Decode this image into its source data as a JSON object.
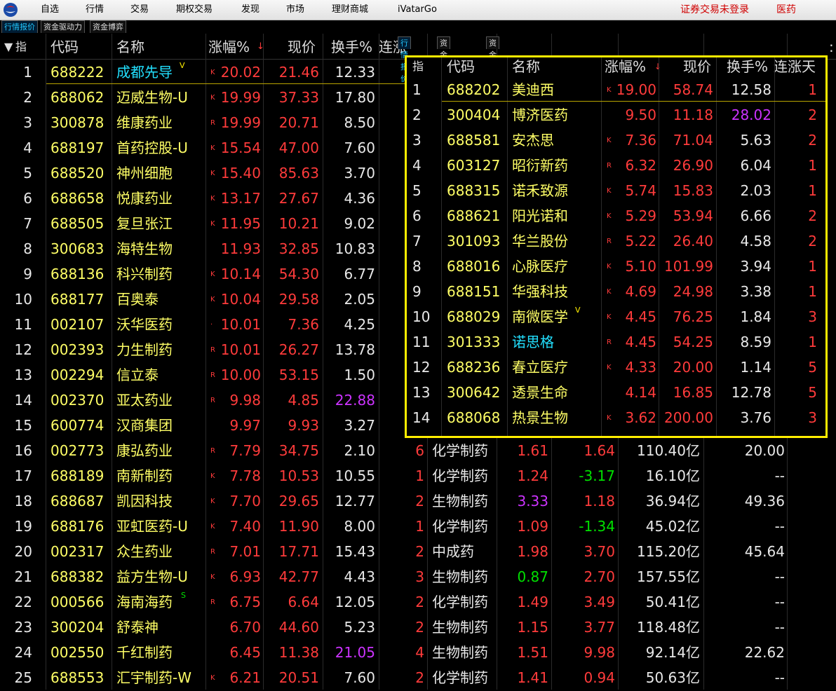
{
  "menu": {
    "items": [
      "自选",
      "行情",
      "交易",
      "期权交易",
      "发现",
      "市场",
      "理财商城",
      "iVatarGo"
    ],
    "login_status": "证券交易未登录",
    "sector": "医药"
  },
  "tabs": [
    "行情报价",
    "资金驱动力",
    "资金博弈"
  ],
  "table": {
    "headers": [
      "指",
      "代码",
      "名称",
      "涨幅%",
      "现价",
      "换手%",
      "连涨"
    ],
    "rows": [
      {
        "idx": "1",
        "code": "688222",
        "name": "成都先导",
        "name_color": "cyan",
        "sup": "V",
        "flag": "K",
        "chg": "20.02",
        "price": "21.46",
        "turn": "12.33"
      },
      {
        "idx": "2",
        "code": "688062",
        "name": "迈威生物-U",
        "flag": "K",
        "chg": "19.99",
        "price": "37.33",
        "turn": "17.80"
      },
      {
        "idx": "3",
        "code": "300878",
        "name": "维康药业",
        "flag": "R",
        "chg": "19.99",
        "price": "20.71",
        "turn": "8.50"
      },
      {
        "idx": "4",
        "code": "688197",
        "name": "首药控股-U",
        "flag": "K",
        "chg": "15.54",
        "price": "47.00",
        "turn": "7.60"
      },
      {
        "idx": "5",
        "code": "688520",
        "name": "神州细胞",
        "flag": "K",
        "chg": "15.40",
        "price": "85.63",
        "turn": "3.70"
      },
      {
        "idx": "6",
        "code": "688658",
        "name": "悦康药业",
        "flag": "K",
        "chg": "13.17",
        "price": "27.67",
        "turn": "4.36"
      },
      {
        "idx": "7",
        "code": "688505",
        "name": "复旦张江",
        "flag": "K",
        "chg": "11.95",
        "price": "10.21",
        "turn": "9.02"
      },
      {
        "idx": "8",
        "code": "300683",
        "name": "海特生物",
        "flag": "",
        "chg": "11.93",
        "price": "32.85",
        "turn": "10.83"
      },
      {
        "idx": "9",
        "code": "688136",
        "name": "科兴制药",
        "flag": "K",
        "chg": "10.14",
        "price": "54.30",
        "turn": "6.77"
      },
      {
        "idx": "10",
        "code": "688177",
        "name": "百奥泰",
        "flag": "K",
        "chg": "10.04",
        "price": "29.58",
        "turn": "2.05"
      },
      {
        "idx": "11",
        "code": "002107",
        "name": "沃华医药",
        "flag": "·",
        "chg": "10.01",
        "price": "7.36",
        "turn": "4.25"
      },
      {
        "idx": "12",
        "code": "002393",
        "name": "力生制药",
        "flag": "R",
        "chg": "10.01",
        "price": "26.27",
        "turn": "13.78"
      },
      {
        "idx": "13",
        "code": "002294",
        "name": "信立泰",
        "flag": "R",
        "chg": "10.00",
        "price": "53.15",
        "turn": "1.50"
      },
      {
        "idx": "14",
        "code": "002370",
        "name": "亚太药业",
        "flag": "R",
        "chg": "9.98",
        "price": "4.85",
        "turn": "22.88",
        "turn_color": "purple"
      },
      {
        "idx": "15",
        "code": "600774",
        "name": "汉商集团",
        "flag": "",
        "chg": "9.97",
        "price": "9.93",
        "turn": "3.27"
      },
      {
        "idx": "16",
        "code": "002773",
        "name": "康弘药业",
        "flag": "R",
        "chg": "7.79",
        "price": "34.75",
        "turn": "2.10",
        "streak": "6",
        "industry": "化学制药",
        "c1": "1.61",
        "c1_color": "red",
        "c2": "1.64",
        "c2_color": "red",
        "cap": "110.40亿",
        "pe": "20.00"
      },
      {
        "idx": "17",
        "code": "688189",
        "name": "南新制药",
        "flag": "K",
        "chg": "7.78",
        "price": "10.53",
        "turn": "10.55",
        "streak": "1",
        "industry": "化学制药",
        "c1": "1.24",
        "c1_color": "red",
        "c2": "-3.17",
        "c2_color": "green",
        "cap": "16.10亿",
        "pe": "--"
      },
      {
        "idx": "18",
        "code": "688687",
        "name": "凯因科技",
        "flag": "K",
        "chg": "7.70",
        "price": "29.65",
        "turn": "12.77",
        "streak": "2",
        "industry": "生物制药",
        "c1": "3.33",
        "c1_color": "purple",
        "c2": "1.18",
        "c2_color": "red",
        "cap": "36.94亿",
        "pe": "49.36"
      },
      {
        "idx": "19",
        "code": "688176",
        "name": "亚虹医药-U",
        "flag": "K",
        "chg": "7.40",
        "price": "11.90",
        "turn": "8.00",
        "streak": "1",
        "industry": "化学制药",
        "c1": "1.09",
        "c1_color": "red",
        "c2": "-1.34",
        "c2_color": "green",
        "cap": "45.02亿",
        "pe": "--"
      },
      {
        "idx": "20",
        "code": "002317",
        "name": "众生药业",
        "flag": "R",
        "chg": "7.01",
        "price": "17.71",
        "turn": "15.43",
        "streak": "2",
        "industry": "中成药",
        "c1": "1.98",
        "c1_color": "red",
        "c2": "3.70",
        "c2_color": "red",
        "cap": "115.20亿",
        "pe": "45.64"
      },
      {
        "idx": "21",
        "code": "688382",
        "name": "益方生物-U",
        "flag": "K",
        "chg": "6.93",
        "price": "42.77",
        "turn": "4.43",
        "streak": "3",
        "industry": "生物制药",
        "c1": "0.87",
        "c1_color": "green",
        "c2": "2.70",
        "c2_color": "red",
        "cap": "157.55亿",
        "pe": "--"
      },
      {
        "idx": "22",
        "code": "000566",
        "name": "海南海药",
        "sup": "S",
        "flag": "R",
        "chg": "6.75",
        "price": "6.64",
        "turn": "12.05",
        "streak": "2",
        "industry": "化学制药",
        "c1": "1.49",
        "c1_color": "red",
        "c2": "3.49",
        "c2_color": "red",
        "cap": "50.41亿",
        "pe": "--"
      },
      {
        "idx": "23",
        "code": "300204",
        "name": "舒泰神",
        "flag": "",
        "chg": "6.70",
        "price": "44.60",
        "turn": "5.23",
        "streak": "2",
        "industry": "生物制药",
        "c1": "1.15",
        "c1_color": "red",
        "c2": "3.77",
        "c2_color": "red",
        "cap": "118.48亿",
        "pe": "--"
      },
      {
        "idx": "24",
        "code": "002550",
        "name": "千红制药",
        "flag": "",
        "chg": "6.45",
        "price": "11.38",
        "turn": "21.05",
        "turn_color": "purple",
        "streak": "4",
        "industry": "生物制药",
        "c1": "1.51",
        "c1_color": "red",
        "c2": "9.98",
        "c2_color": "red",
        "cap": "92.14亿",
        "pe": "22.62"
      },
      {
        "idx": "25",
        "code": "688553",
        "name": "汇宇制药-W",
        "flag": "K",
        "chg": "6.21",
        "price": "20.51",
        "turn": "7.60",
        "streak": "2",
        "industry": "化学制药",
        "c1": "1.41",
        "c1_color": "red",
        "c2": "0.94",
        "c2_color": "red",
        "cap": "50.63亿",
        "pe": "--"
      }
    ]
  },
  "popup": {
    "tabs": [
      "行情报价",
      "资金驱动力",
      "资金博弈"
    ],
    "headers": [
      "指",
      "代码",
      "名称",
      "涨幅%",
      "现价",
      "换手%",
      "连涨天"
    ],
    "rows": [
      {
        "idx": "1",
        "code": "688202",
        "name": "美迪西",
        "flag": "K",
        "chg": "19.00",
        "price": "58.74",
        "turn": "12.58",
        "streak": "1"
      },
      {
        "idx": "2",
        "code": "300404",
        "name": "博济医药",
        "flag": "",
        "chg": "9.50",
        "price": "11.18",
        "turn": "28.02",
        "turn_color": "purple",
        "streak": "2"
      },
      {
        "idx": "3",
        "code": "688581",
        "name": "安杰思",
        "flag": "K",
        "chg": "7.36",
        "price": "71.04",
        "turn": "5.63",
        "streak": "2"
      },
      {
        "idx": "4",
        "code": "603127",
        "name": "昭衍新药",
        "flag": "R",
        "chg": "6.32",
        "price": "26.90",
        "turn": "6.04",
        "streak": "1"
      },
      {
        "idx": "5",
        "code": "688315",
        "name": "诺禾致源",
        "flag": "K",
        "chg": "5.74",
        "price": "15.83",
        "turn": "2.03",
        "streak": "1"
      },
      {
        "idx": "6",
        "code": "688621",
        "name": "阳光诺和",
        "flag": "K",
        "chg": "5.29",
        "price": "53.94",
        "turn": "6.66",
        "streak": "2"
      },
      {
        "idx": "7",
        "code": "301093",
        "name": "华兰股份",
        "flag": "R",
        "chg": "5.22",
        "price": "26.40",
        "turn": "4.58",
        "streak": "2"
      },
      {
        "idx": "8",
        "code": "688016",
        "name": "心脉医疗",
        "flag": "K",
        "chg": "5.10",
        "price": "101.99",
        "turn": "3.94",
        "streak": "1"
      },
      {
        "idx": "9",
        "code": "688151",
        "name": "华强科技",
        "flag": "K",
        "chg": "4.69",
        "price": "24.98",
        "turn": "3.38",
        "streak": "1"
      },
      {
        "idx": "10",
        "code": "688029",
        "name": "南微医学",
        "sup": "V",
        "flag": "K",
        "chg": "4.45",
        "price": "76.25",
        "turn": "1.84",
        "streak": "3"
      },
      {
        "idx": "11",
        "code": "301333",
        "name": "诺思格",
        "name_color": "cyan",
        "flag": "R",
        "chg": "4.45",
        "price": "54.25",
        "turn": "8.59",
        "streak": "1"
      },
      {
        "idx": "12",
        "code": "688236",
        "name": "春立医疗",
        "flag": "K",
        "chg": "4.33",
        "price": "20.00",
        "turn": "1.14",
        "streak": "5"
      },
      {
        "idx": "13",
        "code": "300642",
        "name": "透景生命",
        "flag": "",
        "chg": "4.14",
        "price": "16.85",
        "turn": "12.78",
        "streak": "5"
      },
      {
        "idx": "14",
        "code": "688068",
        "name": "热景生物",
        "flag": "K",
        "chg": "3.62",
        "price": "200.00",
        "turn": "3.76",
        "streak": "3"
      }
    ]
  },
  "colors": {
    "accent_yellow": "#ffee00",
    "up_red": "#ff3b3b",
    "down_green": "#00e000",
    "code_yellow": "#ffff66",
    "cyan": "#22e0ff",
    "purple": "#cc33ff"
  },
  "icons": {
    "logo": "app-logo-icon",
    "sort": "sort-desc-icon"
  }
}
